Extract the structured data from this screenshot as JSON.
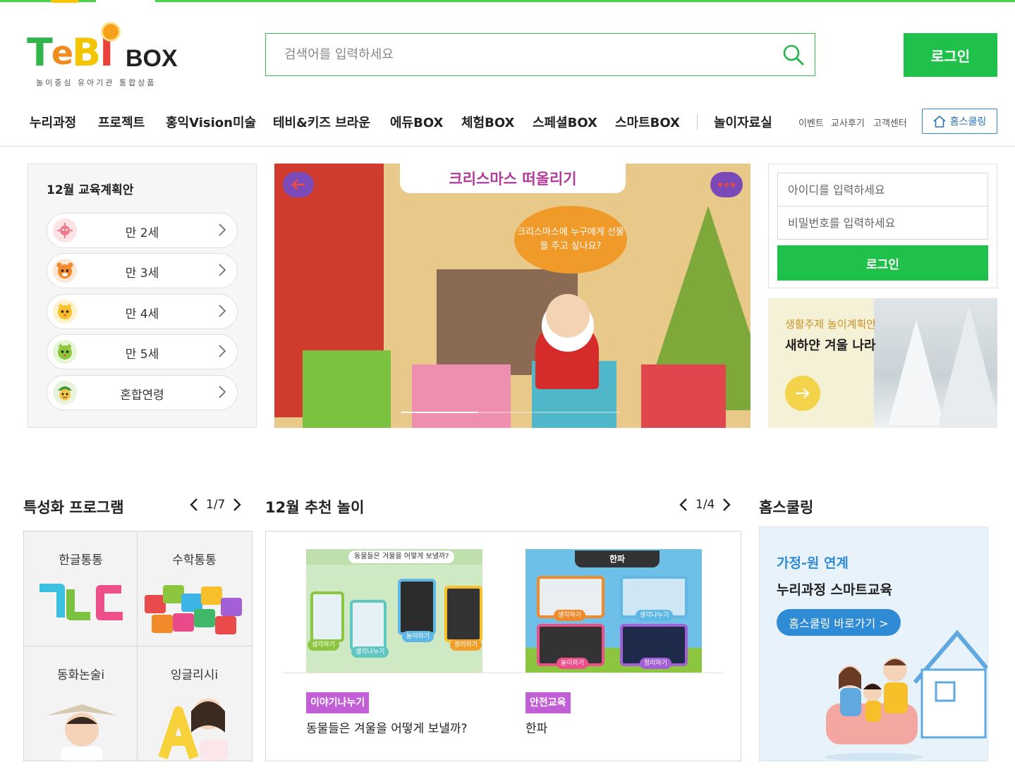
{
  "header": {
    "logo_tagline": "놀이중심 유아기관 통합상품",
    "search_placeholder": "검색어를 입력하세요",
    "login_label": "로그인"
  },
  "nav": {
    "items": [
      "누리과정",
      "프로젝트",
      "홍익Vision미술",
      "테비&키즈 브라운",
      "에듀BOX",
      "체험BOX",
      "스페셜BOX",
      "스마트BOX",
      "놀이자료실"
    ],
    "utils": [
      "이벤트",
      "교사후기",
      "고객센터"
    ],
    "homeschool_label": "홈스쿨링"
  },
  "agepanel": {
    "title": "12월 교육계획안",
    "items": [
      "만 2세",
      "만 3세",
      "만 4세",
      "만 5세",
      "혼합연령"
    ]
  },
  "hero": {
    "title": "크리스마스 떠올리기",
    "bubble": "크리스마스에 누구에게 선물을 주고 싶나요?",
    "progress": 0.35
  },
  "login": {
    "id_placeholder": "아이디를 입력하세요",
    "pw_placeholder": "비밀번호를 입력하세요",
    "button": "로그인"
  },
  "winter": {
    "subtitle": "생활주제 놀이계획안",
    "title": "새하얀 겨울 나라"
  },
  "programs": {
    "title": "특성화 프로그램",
    "page": "1/7",
    "items": [
      "한글통통",
      "수학통통",
      "동화논술i",
      "잉글리시i"
    ]
  },
  "recommend": {
    "title": "12월 추천 놀이",
    "page": "1/4",
    "cards": [
      {
        "tag": "이야기나누기",
        "title": "동물들은 겨울을 어떻게 보낼까?",
        "thumb_caption": "동물들은 겨울을 어떻게 보낼까?",
        "thumb_labels": [
          "생각하기",
          "생각나누기",
          "놀이하기",
          "정리하기"
        ]
      },
      {
        "tag": "안전교육",
        "title": "한파",
        "thumb_caption": "한파",
        "thumb_labels": [
          "생각하기",
          "생각나누기",
          "놀이하기",
          "정리하기"
        ]
      }
    ]
  },
  "homeschool": {
    "title": "홈스쿨링",
    "line1": "가정-원 연계",
    "line2": "누리과정 스마트교육",
    "button": "홈스쿨링 바로가기 >"
  },
  "colors": {
    "brand_green": "#20c14a",
    "accent_blue": "#2e8bd4",
    "tag_purple": "#c25fd6"
  }
}
